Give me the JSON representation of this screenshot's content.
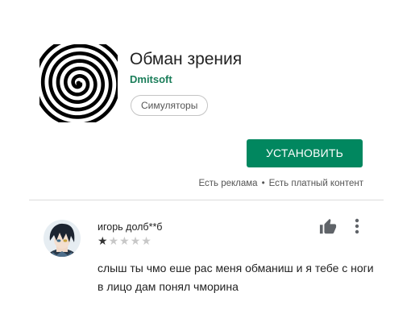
{
  "app": {
    "title": "Обман зрения",
    "developer": "Dmitsoft",
    "category": "Симуляторы",
    "icon": "hypnotic-spiral-icon"
  },
  "install": {
    "label": "УСТАНОВИТЬ",
    "color": "#01875f"
  },
  "ads_info": {
    "ads": "Есть реклама",
    "separator": "•",
    "paid": "Есть платный контент"
  },
  "review": {
    "author": "игорь долб**б",
    "rating": 1,
    "max_rating": 5,
    "text": "слыш ты чмо еше рас меня обманиш и я тебе с ноги в лицо дам понял чморина",
    "avatar": "anime-avatar",
    "like_icon": "thumbs-up-icon",
    "menu_icon": "more-vert-icon"
  }
}
